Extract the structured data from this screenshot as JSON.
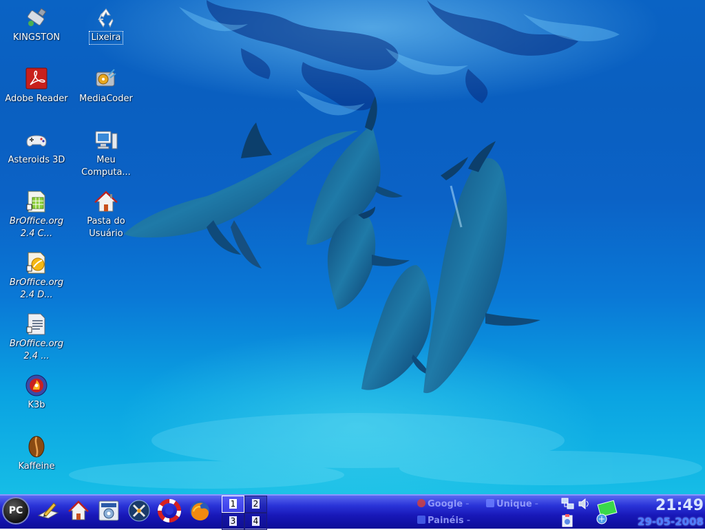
{
  "desktop": {
    "wallpaper": "dolphins-underwater",
    "icons": [
      {
        "id": "kingston",
        "label": "KINGSTON",
        "icon": "usb-drive-icon"
      },
      {
        "id": "lixeira",
        "label": "Lixeira",
        "icon": "trash-icon",
        "selected": true
      },
      {
        "id": "adobe",
        "label": "Adobe Reader",
        "icon": "adobe-reader-icon"
      },
      {
        "id": "mediacoder",
        "label": "MediaCoder",
        "icon": "mediacoder-icon"
      },
      {
        "id": "asteroids",
        "label": "Asteroids 3D",
        "icon": "gamepad-icon"
      },
      {
        "id": "computer",
        "label": "Meu Computa...",
        "icon": "computer-icon"
      },
      {
        "id": "broffice-calc",
        "label": "BrOffice.org 2.4 C...",
        "icon": "calc-icon"
      },
      {
        "id": "home",
        "label": "Pasta do Usuário",
        "icon": "home-folder-icon"
      },
      {
        "id": "broffice-draw",
        "label": "BrOffice.org 2.4 D...",
        "icon": "draw-icon"
      },
      {
        "id": "broffice-writer",
        "label": "BrOffice.org 2.4 ...",
        "icon": "writer-icon"
      },
      {
        "id": "k3b",
        "label": "K3b",
        "icon": "k3b-icon"
      },
      {
        "id": "kaffeine",
        "label": "Kaffeine",
        "icon": "kaffeine-icon"
      }
    ]
  },
  "taskbar": {
    "kmenu_label": "PC",
    "launchers": [
      {
        "name": "editor",
        "icon": "text-editor-icon"
      },
      {
        "name": "home",
        "icon": "home-icon"
      },
      {
        "name": "control-center",
        "icon": "control-center-icon"
      },
      {
        "name": "tools",
        "icon": "tools-icon"
      },
      {
        "name": "rescue",
        "icon": "lifebuoy-icon"
      },
      {
        "name": "firefox",
        "icon": "firefox-icon"
      }
    ],
    "pager": [
      "1",
      "2",
      "3",
      "4"
    ],
    "active_desktop": "1",
    "bookmarks": [
      {
        "label": "Google",
        "dash": "-",
        "color": "#d04040"
      },
      {
        "label": "Unique",
        "dash": "-",
        "color": "#6a7cff"
      },
      {
        "label": "Painéis",
        "dash": "-",
        "color": "#4a64ee"
      }
    ],
    "tray": [
      {
        "name": "network",
        "icon": "network-icon"
      },
      {
        "name": "volume",
        "icon": "speaker-icon"
      },
      {
        "name": "klipper",
        "icon": "clipboard-icon"
      },
      {
        "name": "knetworkmanager",
        "icon": "wireless-icon"
      }
    ],
    "clock": {
      "time": "21:49",
      "date": "29-05-2008"
    }
  },
  "colors": {
    "taskbar_top": "#5a68f0",
    "taskbar_bottom": "#0c0c98",
    "clock_time": "#d8e4ff",
    "clock_date": "#4c7cff",
    "water_deep": "#0a5fc0",
    "water_shallow": "#16bde6"
  }
}
